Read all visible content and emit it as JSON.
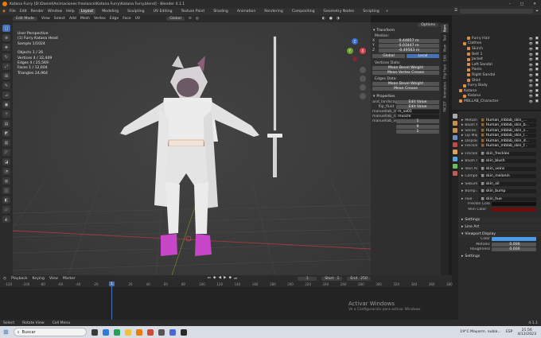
{
  "window": {
    "title": "Katana Furry [D:\\Daniel\\Animaciones freelance\\Katana Furry\\Katana Furry.blend] - Blender 4.1.1"
  },
  "menu": {
    "items": [
      "File",
      "Edit",
      "Render",
      "Window",
      "Help"
    ],
    "workspaces": [
      "Layout",
      "Modeling",
      "Sculpting",
      "UV Editing",
      "Texture Paint",
      "Shading",
      "Animation",
      "Rendering",
      "Compositing",
      "Geometry Nodes",
      "Scripting"
    ],
    "active_workspace": "Layout",
    "scene": "Scene",
    "view_layer": "ViewLayer"
  },
  "viewport_header": {
    "mode": "Edit Mode",
    "items": [
      "View",
      "Select",
      "Add",
      "Mesh",
      "Vertex",
      "Edge",
      "Face",
      "UV"
    ],
    "orientation": "Global",
    "options": "Options"
  },
  "viewport_info": {
    "lines": [
      "User Perspective",
      "(1) Furry Katana Head",
      "Sample 1/1024",
      "",
      "Objects   1 / 26",
      "Vertices  4 / 32,449",
      "Edges     4 / 25,569",
      "Faces     1 / 12,604",
      "Triangles 24,964"
    ]
  },
  "npanel": {
    "transform": {
      "title": "Transform",
      "median_label": "Median:",
      "x_label": "X",
      "x": "0.44857 m",
      "y_label": "Y",
      "y": "0.03447 m",
      "z_label": "Z",
      "z": "-0.49563 m",
      "global": "Global",
      "local": "Local"
    },
    "vertex_data": {
      "title": "Vertices Data:",
      "mean_bevel": "Mean Bevel Weight",
      "mean_crease": "Mean Vertex Crease",
      "mean_bevel_val": "0.00",
      "mean_crease_val": "0.00"
    },
    "edges_data": {
      "title": "Edges Data:",
      "mean_bevel": "Mean Bevel Weight",
      "mean_crease": "Mean Crease",
      "mean_bevel_val": "0.00",
      "mean_crease_val": "0.00"
    },
    "properties": {
      "title": "Properties",
      "rows": [
        {
          "label": "and_landscape",
          "value": "Edit Value"
        },
        {
          "label": "flip_fluid",
          "value": "Edit Value"
        },
        {
          "label": "manuellab_id",
          "value": "m_sa01"
        },
        {
          "label": "manuellab_rig",
          "value": "muscle"
        },
        {
          "label": "manuellab_vers",
          "value": "1"
        },
        {
          "label": "",
          "value": "9"
        },
        {
          "label": "",
          "value": "1"
        }
      ]
    },
    "tabs": [
      "Item",
      "Tool",
      "View",
      "Edit",
      "Flip Fluid",
      "Animation",
      "FACEIT"
    ]
  },
  "outliner": {
    "rows": [
      {
        "name": "Furry Hair",
        "indent": 3,
        "color": "#e08f3c"
      },
      {
        "name": "Clothes",
        "indent": 2,
        "color": "#e08f3c"
      },
      {
        "name": "Skirch",
        "indent": 3,
        "color": "#e08f3c"
      },
      {
        "name": "Belt 1",
        "indent": 3,
        "color": "#e08f3c"
      },
      {
        "name": "Jacket",
        "indent": 3,
        "color": "#e08f3c"
      },
      {
        "name": "Left Sandal",
        "indent": 3,
        "color": "#e08f3c"
      },
      {
        "name": "Pants",
        "indent": 3,
        "color": "#e08f3c"
      },
      {
        "name": "Right Sandal",
        "indent": 3,
        "color": "#e08f3c"
      },
      {
        "name": "Shirt",
        "indent": 3,
        "color": "#e08f3c"
      },
      {
        "name": "Furry Body",
        "indent": 2,
        "color": "#e08f3c"
      },
      {
        "name": "Katana",
        "indent": 1,
        "color": "#e08f3c"
      },
      {
        "name": "Katana",
        "indent": 2,
        "color": "#e08f3c"
      },
      {
        "name": "MBLLAB_Character",
        "indent": 1,
        "color": "#e08f3c"
      }
    ]
  },
  "props_nodes": {
    "rows": [
      {
        "name": "Metalm...",
        "value": "Human_mblab_skin_..."
      },
      {
        "name": "Blush Map",
        "value": "Human_mblab_skin_b..."
      },
      {
        "name": "Secon...",
        "value": "Human_mblab_skin_s..."
      },
      {
        "name": "Lip Map",
        "value": "Human_mblab_skin_l..."
      },
      {
        "name": "Displac...",
        "value": "Human_mblab_skin_d..."
      },
      {
        "name": "Freckle...",
        "value": "Human_mblab_skin_f..."
      },
      {
        "name": "Freckle...",
        "value": "skin_freckles"
      },
      {
        "name": "Blush A...",
        "value": "skin_blush"
      },
      {
        "name": "Vein Am...",
        "value": "skin_veins"
      },
      {
        "name": "Comple...",
        "value": "skin_melanin"
      },
      {
        "name": "Sebum ...",
        "value": "skin_oil"
      },
      {
        "name": "Bump A...",
        "value": "skin_bump"
      },
      {
        "name": "Hue",
        "value": "skin_hue"
      }
    ],
    "freckle_color": "Freckle Color",
    "vein_color": "Vein Color",
    "sections": [
      "Settings",
      "Line Art",
      "Viewport Display"
    ],
    "vp_color": "Color",
    "vp_metallic": "Metallic",
    "vp_metallic_val": "0.000",
    "vp_roughness": "Roughness",
    "vp_roughness_val": "0.000",
    "settings2": "Settings"
  },
  "timeline": {
    "header_items": [
      "Playback",
      "Keying",
      "View",
      "Marker"
    ],
    "current_frame": "1",
    "start_label": "Start",
    "start": "1",
    "end_label": "End",
    "end": "250",
    "ticks": [
      "-120",
      "-100",
      "-80",
      "-60",
      "-40",
      "-20",
      "0",
      "20",
      "40",
      "60",
      "80",
      "100",
      "120",
      "140",
      "160",
      "180",
      "200",
      "220",
      "240",
      "260",
      "280",
      "300",
      "320",
      "340",
      "360",
      "380"
    ]
  },
  "statusbar": {
    "items": [
      "Select",
      "Rotate View",
      "Call Menu"
    ],
    "version": "4.1.1"
  },
  "taskbar": {
    "search": "Buscar",
    "weather": "19°C  Mayorm. nubla...",
    "lang": "ESP",
    "time": "21:56",
    "date": "4/12/2023"
  },
  "watermark": {
    "title": "Activar Windows",
    "sub": "Ve a Configuración para activar Windows."
  },
  "colors": {
    "accent": "#4772b3",
    "viewport": "#3d3d3d",
    "vein": "#6d0f0f",
    "freckle": "#111111"
  }
}
